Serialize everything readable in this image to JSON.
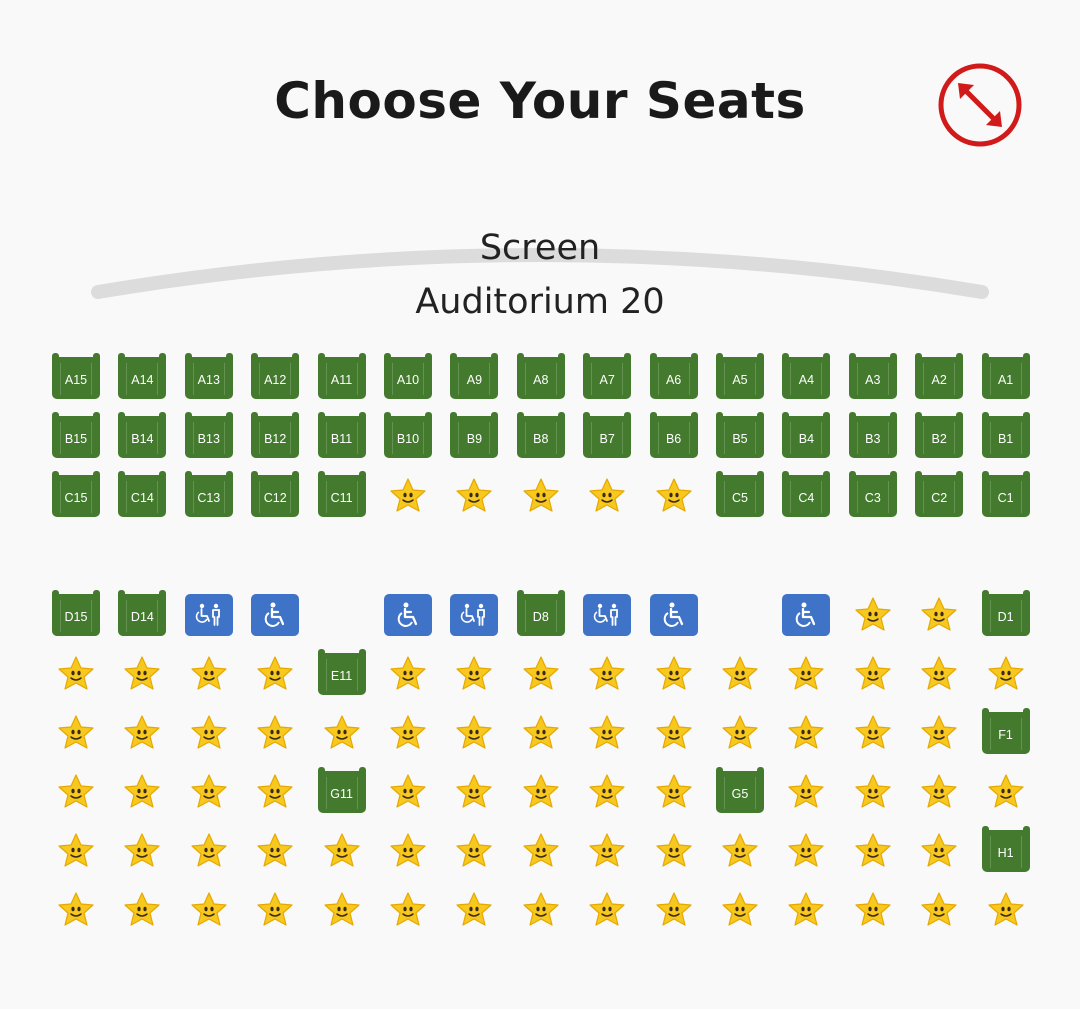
{
  "header": {
    "title": "Choose Your Seats"
  },
  "screen": {
    "label": "Screen",
    "auditorium": "Auditorium 20"
  },
  "seat_map": {
    "rows": [
      {
        "row": "A",
        "seats": [
          {
            "s": "avail",
            "l": "A15"
          },
          {
            "s": "avail",
            "l": "A14"
          },
          {
            "s": "avail",
            "l": "A13"
          },
          {
            "s": "avail",
            "l": "A12"
          },
          {
            "s": "avail",
            "l": "A11"
          },
          {
            "s": "avail",
            "l": "A10"
          },
          {
            "s": "avail",
            "l": "A9"
          },
          {
            "s": "avail",
            "l": "A8"
          },
          {
            "s": "avail",
            "l": "A7"
          },
          {
            "s": "avail",
            "l": "A6"
          },
          {
            "s": "avail",
            "l": "A5"
          },
          {
            "s": "avail",
            "l": "A4"
          },
          {
            "s": "avail",
            "l": "A3"
          },
          {
            "s": "avail",
            "l": "A2"
          },
          {
            "s": "avail",
            "l": "A1"
          }
        ]
      },
      {
        "row": "B",
        "seats": [
          {
            "s": "avail",
            "l": "B15"
          },
          {
            "s": "avail",
            "l": "B14"
          },
          {
            "s": "avail",
            "l": "B13"
          },
          {
            "s": "avail",
            "l": "B12"
          },
          {
            "s": "avail",
            "l": "B11"
          },
          {
            "s": "avail",
            "l": "B10"
          },
          {
            "s": "avail",
            "l": "B9"
          },
          {
            "s": "avail",
            "l": "B8"
          },
          {
            "s": "avail",
            "l": "B7"
          },
          {
            "s": "avail",
            "l": "B6"
          },
          {
            "s": "avail",
            "l": "B5"
          },
          {
            "s": "avail",
            "l": "B4"
          },
          {
            "s": "avail",
            "l": "B3"
          },
          {
            "s": "avail",
            "l": "B2"
          },
          {
            "s": "avail",
            "l": "B1"
          }
        ]
      },
      {
        "row": "C",
        "seats": [
          {
            "s": "avail",
            "l": "C15"
          },
          {
            "s": "avail",
            "l": "C14"
          },
          {
            "s": "avail",
            "l": "C13"
          },
          {
            "s": "avail",
            "l": "C12"
          },
          {
            "s": "avail",
            "l": "C11"
          },
          {
            "s": "taken"
          },
          {
            "s": "taken"
          },
          {
            "s": "taken"
          },
          {
            "s": "taken"
          },
          {
            "s": "taken"
          },
          {
            "s": "avail",
            "l": "C5"
          },
          {
            "s": "avail",
            "l": "C4"
          },
          {
            "s": "avail",
            "l": "C3"
          },
          {
            "s": "avail",
            "l": "C2"
          },
          {
            "s": "avail",
            "l": "C1"
          }
        ]
      },
      {
        "row": "D",
        "seats": [
          {
            "s": "avail",
            "l": "D15"
          },
          {
            "s": "avail",
            "l": "D14"
          },
          {
            "s": "companion"
          },
          {
            "s": "wheelchair"
          },
          {
            "s": "empty"
          },
          {
            "s": "wheelchair"
          },
          {
            "s": "companion"
          },
          {
            "s": "avail",
            "l": "D8"
          },
          {
            "s": "companion"
          },
          {
            "s": "wheelchair"
          },
          {
            "s": "empty"
          },
          {
            "s": "wheelchair"
          },
          {
            "s": "taken"
          },
          {
            "s": "taken"
          },
          {
            "s": "avail",
            "l": "D1"
          }
        ]
      },
      {
        "row": "E",
        "seats": [
          {
            "s": "taken"
          },
          {
            "s": "taken"
          },
          {
            "s": "taken"
          },
          {
            "s": "taken"
          },
          {
            "s": "avail",
            "l": "E11"
          },
          {
            "s": "taken"
          },
          {
            "s": "taken"
          },
          {
            "s": "taken"
          },
          {
            "s": "taken"
          },
          {
            "s": "taken"
          },
          {
            "s": "taken"
          },
          {
            "s": "taken"
          },
          {
            "s": "taken"
          },
          {
            "s": "taken"
          },
          {
            "s": "taken"
          }
        ]
      },
      {
        "row": "F",
        "seats": [
          {
            "s": "taken"
          },
          {
            "s": "taken"
          },
          {
            "s": "taken"
          },
          {
            "s": "taken"
          },
          {
            "s": "taken"
          },
          {
            "s": "taken"
          },
          {
            "s": "taken"
          },
          {
            "s": "taken"
          },
          {
            "s": "taken"
          },
          {
            "s": "taken"
          },
          {
            "s": "taken"
          },
          {
            "s": "taken"
          },
          {
            "s": "taken"
          },
          {
            "s": "taken"
          },
          {
            "s": "avail",
            "l": "F1"
          }
        ]
      },
      {
        "row": "G",
        "seats": [
          {
            "s": "taken"
          },
          {
            "s": "taken"
          },
          {
            "s": "taken"
          },
          {
            "s": "taken"
          },
          {
            "s": "avail",
            "l": "G11"
          },
          {
            "s": "taken"
          },
          {
            "s": "taken"
          },
          {
            "s": "taken"
          },
          {
            "s": "taken"
          },
          {
            "s": "taken"
          },
          {
            "s": "avail",
            "l": "G5"
          },
          {
            "s": "taken"
          },
          {
            "s": "taken"
          },
          {
            "s": "taken"
          },
          {
            "s": "taken"
          }
        ]
      },
      {
        "row": "H",
        "seats": [
          {
            "s": "taken"
          },
          {
            "s": "taken"
          },
          {
            "s": "taken"
          },
          {
            "s": "taken"
          },
          {
            "s": "taken"
          },
          {
            "s": "taken"
          },
          {
            "s": "taken"
          },
          {
            "s": "taken"
          },
          {
            "s": "taken"
          },
          {
            "s": "taken"
          },
          {
            "s": "taken"
          },
          {
            "s": "taken"
          },
          {
            "s": "taken"
          },
          {
            "s": "taken"
          },
          {
            "s": "avail",
            "l": "H1"
          }
        ]
      },
      {
        "row": "I",
        "seats": [
          {
            "s": "taken"
          },
          {
            "s": "taken"
          },
          {
            "s": "taken"
          },
          {
            "s": "taken"
          },
          {
            "s": "taken"
          },
          {
            "s": "taken"
          },
          {
            "s": "taken"
          },
          {
            "s": "taken"
          },
          {
            "s": "taken"
          },
          {
            "s": "taken"
          },
          {
            "s": "taken"
          },
          {
            "s": "taken"
          },
          {
            "s": "taken"
          },
          {
            "s": "taken"
          },
          {
            "s": "taken"
          }
        ]
      }
    ]
  },
  "icons": {
    "expand": "expand-arrows-icon",
    "taken": "star-face-icon",
    "wheelchair": "wheelchair-icon",
    "companion": "companion-seat-icon"
  },
  "colors": {
    "available_seat": "#437a2e",
    "accessible_seat": "#3f73c7",
    "expand_accent": "#d11a1a",
    "star": "#f7c81e"
  }
}
